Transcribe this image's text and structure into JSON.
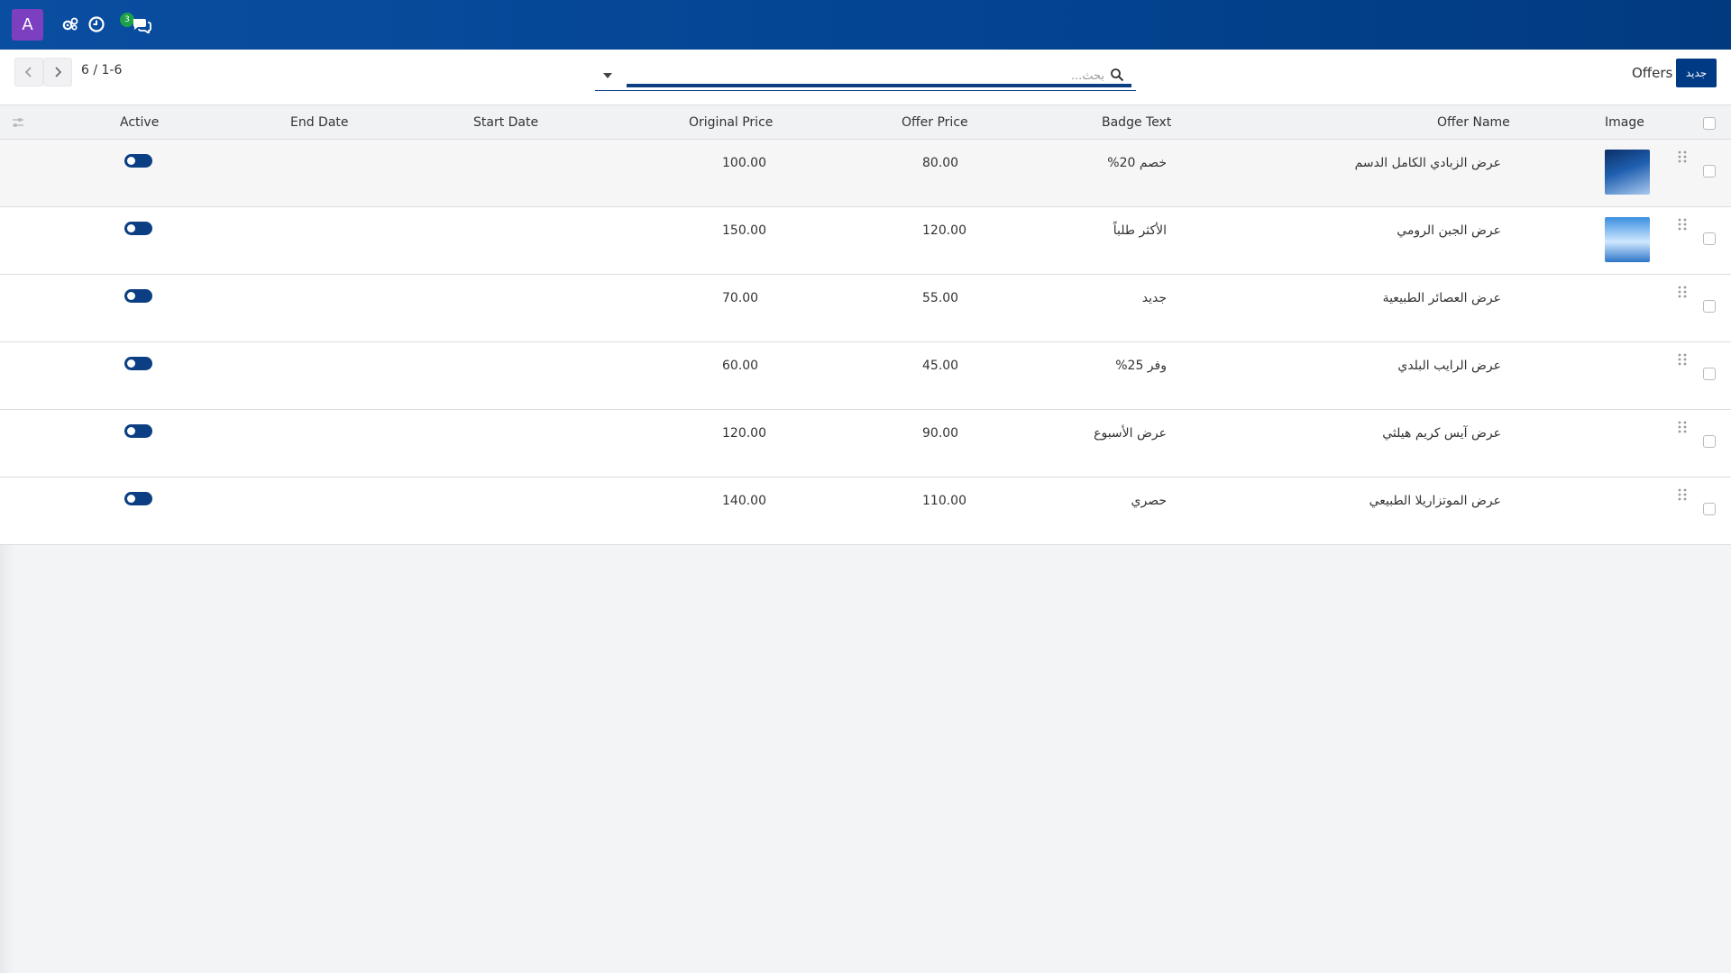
{
  "navbar": {
    "avatar_letter": "A",
    "icons": [
      "settings-cog-icon",
      "clock-icon",
      "chat-icon"
    ],
    "chat_badge_count": "3",
    "brand_color": "#0a4ea1"
  },
  "control": {
    "pager": "6 / 1-6",
    "search_placeholder": "بحث...",
    "breadcrumb_title": "Offers",
    "new_button_label": "جديد"
  },
  "table": {
    "headers": {
      "image": "Image",
      "offer_name": "Offer Name",
      "badge_text": "Badge Text",
      "offer_price": "Offer Price",
      "original_price": "Original Price",
      "start_date": "Start Date",
      "end_date": "End Date",
      "active": "Active"
    },
    "rows": [
      {
        "offer_name": "عرض الزبادي الكامل الدسم",
        "badge_text": "خصم 20%",
        "offer_price": "80.00",
        "original_price": "100.00",
        "start_date": "",
        "end_date": "",
        "active": true,
        "has_image": true
      },
      {
        "offer_name": "عرض الجبن الرومي",
        "badge_text": "الأكثر طلباً",
        "offer_price": "120.00",
        "original_price": "150.00",
        "start_date": "",
        "end_date": "",
        "active": true,
        "has_image": true
      },
      {
        "offer_name": "عرض العصائر الطبيعية",
        "badge_text": "جديد",
        "offer_price": "55.00",
        "original_price": "70.00",
        "start_date": "",
        "end_date": "",
        "active": true,
        "has_image": false
      },
      {
        "offer_name": "عرض الرايب البلدي",
        "badge_text": "وفر 25%",
        "offer_price": "45.00",
        "original_price": "60.00",
        "start_date": "",
        "end_date": "",
        "active": true,
        "has_image": false
      },
      {
        "offer_name": "عرض آيس كريم هيلثي",
        "badge_text": "عرض الأسبوع",
        "offer_price": "90.00",
        "original_price": "120.00",
        "start_date": "",
        "end_date": "",
        "active": true,
        "has_image": false
      },
      {
        "offer_name": "عرض الموتزاريلا الطبيعي",
        "badge_text": "حصري",
        "offer_price": "110.00",
        "original_price": "140.00",
        "start_date": "",
        "end_date": "",
        "active": true,
        "has_image": false
      }
    ]
  }
}
